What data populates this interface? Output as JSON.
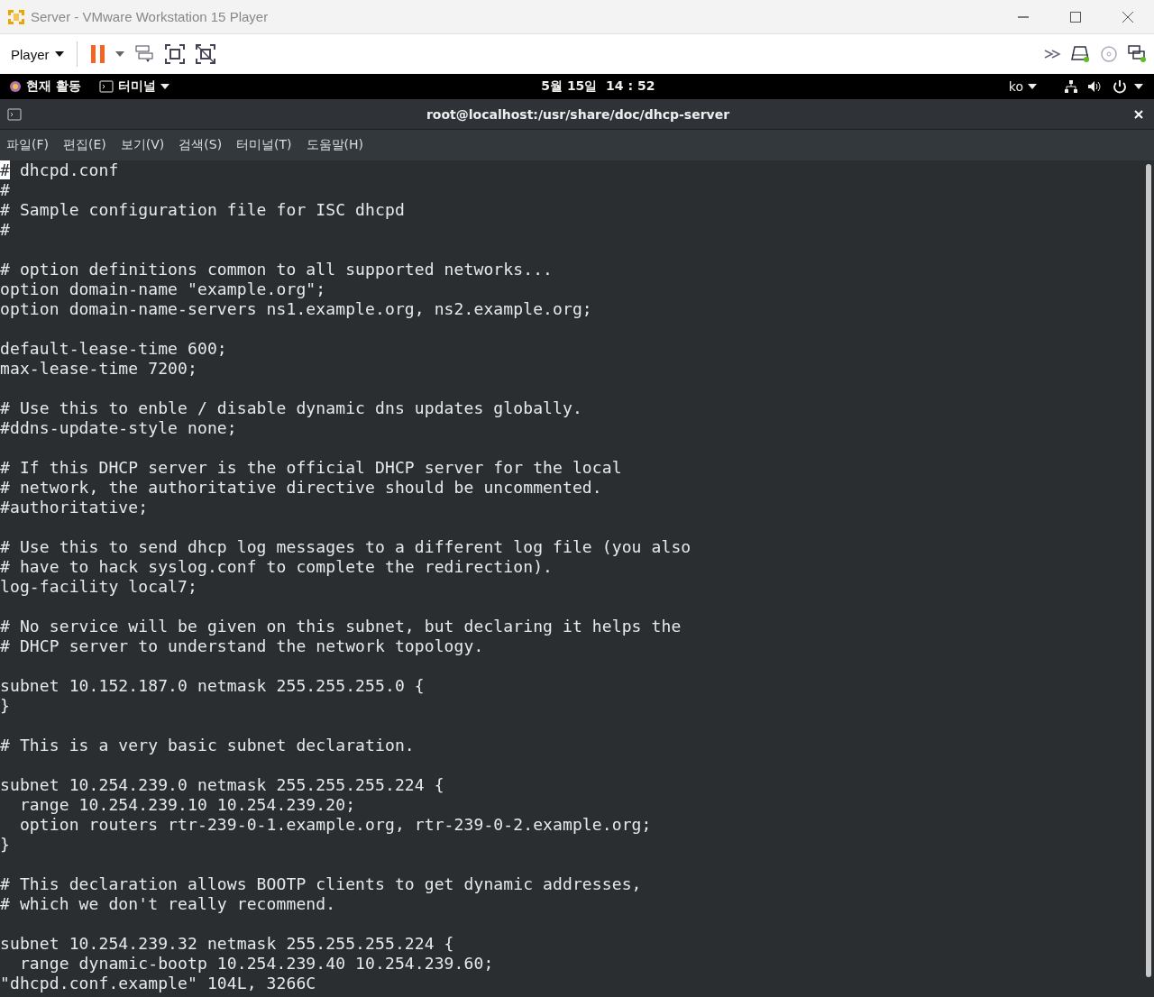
{
  "window": {
    "title": "Server - VMware Workstation 15 Player"
  },
  "toolbar": {
    "player_menu": "Player",
    "paused": true
  },
  "top_bar": {
    "activities": "현재 활동",
    "app_menu": "터미널",
    "clock": "5월 15일  14 : 52",
    "input_method": "ko"
  },
  "terminal": {
    "title": "root@localhost:/usr/share/doc/dhcp-server",
    "menu": [
      {
        "label": "파일(F)"
      },
      {
        "label": "편집(E)"
      },
      {
        "label": "보기(V)"
      },
      {
        "label": "검색(S)"
      },
      {
        "label": "터미널(T)"
      },
      {
        "label": "도움말(H)"
      }
    ],
    "lines": [
      {
        "kind": "text",
        "text": "# dhcpd.conf",
        "cursor": true
      },
      {
        "kind": "text",
        "text": "#",
        "cursor": false
      },
      {
        "kind": "text",
        "text": "# Sample configuration file for ISC dhcpd",
        "cursor": false
      },
      {
        "kind": "text",
        "text": "#",
        "cursor": false
      },
      {
        "kind": "blank"
      },
      {
        "kind": "text",
        "text": "# option definitions common to all supported networks...",
        "cursor": false
      },
      {
        "kind": "text",
        "text": "option domain-name \"example.org\";",
        "cursor": false
      },
      {
        "kind": "text",
        "text": "option domain-name-servers ns1.example.org, ns2.example.org;",
        "cursor": false
      },
      {
        "kind": "blank"
      },
      {
        "kind": "text",
        "text": "default-lease-time 600;",
        "cursor": false
      },
      {
        "kind": "text",
        "text": "max-lease-time 7200;",
        "cursor": false
      },
      {
        "kind": "blank"
      },
      {
        "kind": "text",
        "text": "# Use this to enble / disable dynamic dns updates globally.",
        "cursor": false
      },
      {
        "kind": "text",
        "text": "#ddns-update-style none;",
        "cursor": false
      },
      {
        "kind": "blank"
      },
      {
        "kind": "text",
        "text": "# If this DHCP server is the official DHCP server for the local",
        "cursor": false
      },
      {
        "kind": "text",
        "text": "# network, the authoritative directive should be uncommented.",
        "cursor": false
      },
      {
        "kind": "text",
        "text": "#authoritative;",
        "cursor": false
      },
      {
        "kind": "blank"
      },
      {
        "kind": "text",
        "text": "# Use this to send dhcp log messages to a different log file (you also",
        "cursor": false
      },
      {
        "kind": "text",
        "text": "# have to hack syslog.conf to complete the redirection).",
        "cursor": false
      },
      {
        "kind": "text",
        "text": "log-facility local7;",
        "cursor": false
      },
      {
        "kind": "blank"
      },
      {
        "kind": "text",
        "text": "# No service will be given on this subnet, but declaring it helps the",
        "cursor": false
      },
      {
        "kind": "text",
        "text": "# DHCP server to understand the network topology.",
        "cursor": false
      },
      {
        "kind": "blank"
      },
      {
        "kind": "text",
        "text": "subnet 10.152.187.0 netmask 255.255.255.0 {",
        "cursor": false
      },
      {
        "kind": "text",
        "text": "}",
        "cursor": false
      },
      {
        "kind": "blank"
      },
      {
        "kind": "text",
        "text": "# This is a very basic subnet declaration.",
        "cursor": false
      },
      {
        "kind": "blank"
      },
      {
        "kind": "text",
        "text": "subnet 10.254.239.0 netmask 255.255.255.224 {",
        "cursor": false
      },
      {
        "kind": "text",
        "text": "  range 10.254.239.10 10.254.239.20;",
        "cursor": false
      },
      {
        "kind": "text",
        "text": "  option routers rtr-239-0-1.example.org, rtr-239-0-2.example.org;",
        "cursor": false
      },
      {
        "kind": "text",
        "text": "}",
        "cursor": false
      },
      {
        "kind": "blank"
      },
      {
        "kind": "text",
        "text": "# This declaration allows BOOTP clients to get dynamic addresses,",
        "cursor": false
      },
      {
        "kind": "text",
        "text": "# which we don't really recommend.",
        "cursor": false
      },
      {
        "kind": "blank"
      },
      {
        "kind": "text",
        "text": "subnet 10.254.239.32 netmask 255.255.255.224 {",
        "cursor": false
      },
      {
        "kind": "text",
        "text": "  range dynamic-bootp 10.254.239.40 10.254.239.60;",
        "cursor": false
      },
      {
        "kind": "text",
        "text": "\"dhcpd.conf.example\" 104L, 3266C",
        "cursor": false
      }
    ]
  }
}
